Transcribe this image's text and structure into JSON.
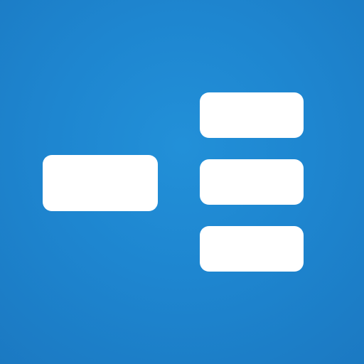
{
  "icon": {
    "name": "mind-map-app-icon",
    "background_color": "#1e86d0",
    "block_color": "#ffffff",
    "blocks": [
      "root-node",
      "child-node",
      "child-node",
      "child-node"
    ]
  }
}
